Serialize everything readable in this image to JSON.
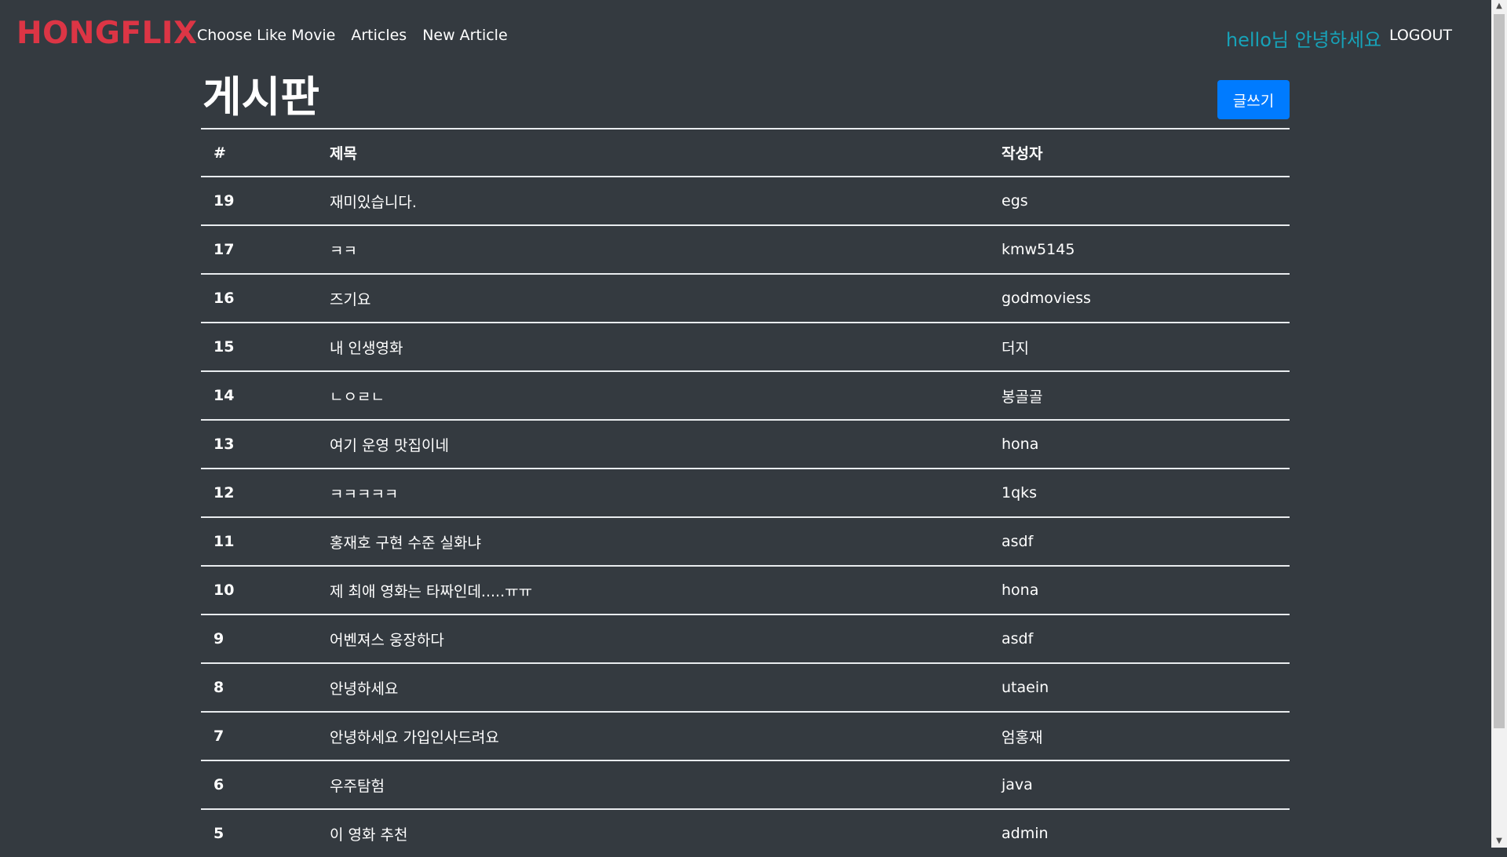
{
  "navbar": {
    "brand": "HONGFLIX",
    "links": [
      "Choose Like Movie",
      "Articles",
      "New Article"
    ],
    "greeting": "hello님 안녕하세요",
    "logout": "LOGOUT"
  },
  "board": {
    "title": "게시판",
    "write_button": "글쓰기",
    "columns": [
      "#",
      "제목",
      "작성자"
    ],
    "rows": [
      {
        "id": "19",
        "title": "재미있습니다.",
        "author": "egs"
      },
      {
        "id": "17",
        "title": "ㅋㅋ",
        "author": "kmw5145"
      },
      {
        "id": "16",
        "title": "즈기요",
        "author": "godmoviess"
      },
      {
        "id": "15",
        "title": "내 인생영화",
        "author": "더지"
      },
      {
        "id": "14",
        "title": "ㄴㅇㄹㄴ",
        "author": "봉골골"
      },
      {
        "id": "13",
        "title": "여기 운영 맛집이네",
        "author": "hona"
      },
      {
        "id": "12",
        "title": "ㅋㅋㅋㅋㅋ",
        "author": "1qks"
      },
      {
        "id": "11",
        "title": "홍재호 구현 수준 실화냐",
        "author": "asdf"
      },
      {
        "id": "10",
        "title": "제 최애 영화는 타짜인데.....ㅠㅠ",
        "author": "hona"
      },
      {
        "id": "9",
        "title": "어벤져스 웅장하다",
        "author": "asdf"
      },
      {
        "id": "8",
        "title": "안녕하세요",
        "author": "utaein"
      },
      {
        "id": "7",
        "title": "안녕하세요 가입인사드려요",
        "author": "엄홍재"
      },
      {
        "id": "6",
        "title": "우주탐험",
        "author": "java"
      },
      {
        "id": "5",
        "title": "이 영화 추천",
        "author": "admin"
      }
    ]
  },
  "colors": {
    "background": "#343a40",
    "brand": "#dc3545",
    "greeting": "#17a2b8",
    "button": "#007bff"
  }
}
